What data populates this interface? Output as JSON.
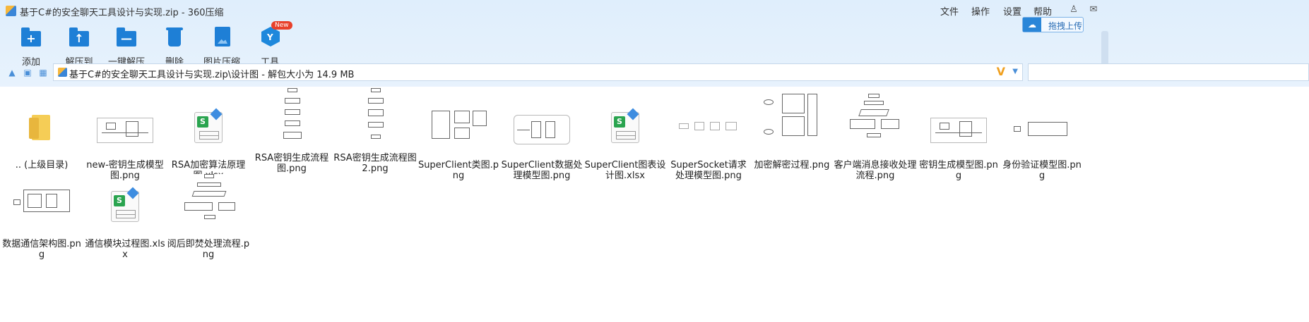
{
  "window": {
    "title": "基于C#的安全聊天工具设计与实现.zip - 360压缩"
  },
  "menu": [
    "文件",
    "操作",
    "设置",
    "帮助"
  ],
  "toolbar": {
    "add": "添加",
    "extract_to": "解压到",
    "one_click_extract": "一键解压",
    "delete": "删除",
    "image_compress": "图片压缩",
    "tools": "工具",
    "tools_badge": "New"
  },
  "upload_button": "拖拽上传",
  "address": {
    "path": "基于C#的安全聊天工具设计与实现.zip\\设计图 - 解包大小为 14.9 MB"
  },
  "files": [
    {
      "name": ".. (上级目录)",
      "type": "folder"
    },
    {
      "name": "new-密钥生成模型图.png",
      "type": "png"
    },
    {
      "name": "RSA加密算法原理图.xlsx",
      "type": "xlsx"
    },
    {
      "name": "RSA密钥生成流程图.png",
      "type": "png"
    },
    {
      "name": "RSA密钥生成流程图2.png",
      "type": "png"
    },
    {
      "name": "SuperClient类图.png",
      "type": "png"
    },
    {
      "name": "SuperClient数据处理模型图.png",
      "type": "png"
    },
    {
      "name": "SuperClient图表设计图.xlsx",
      "type": "xlsx"
    },
    {
      "name": "SuperSocket请求处理模型图.png",
      "type": "png"
    },
    {
      "name": "加密解密过程.png",
      "type": "png"
    },
    {
      "name": "客户端消息接收处理流程.png",
      "type": "png"
    },
    {
      "name": "密钥生成模型图.png",
      "type": "png"
    },
    {
      "name": "身份验证模型图.png",
      "type": "png"
    },
    {
      "name": "数据通信架构图.png",
      "type": "png"
    },
    {
      "name": "通信模块过程图.xlsx",
      "type": "xlsx"
    },
    {
      "name": "阅后即焚处理流程.png",
      "type": "png"
    }
  ]
}
